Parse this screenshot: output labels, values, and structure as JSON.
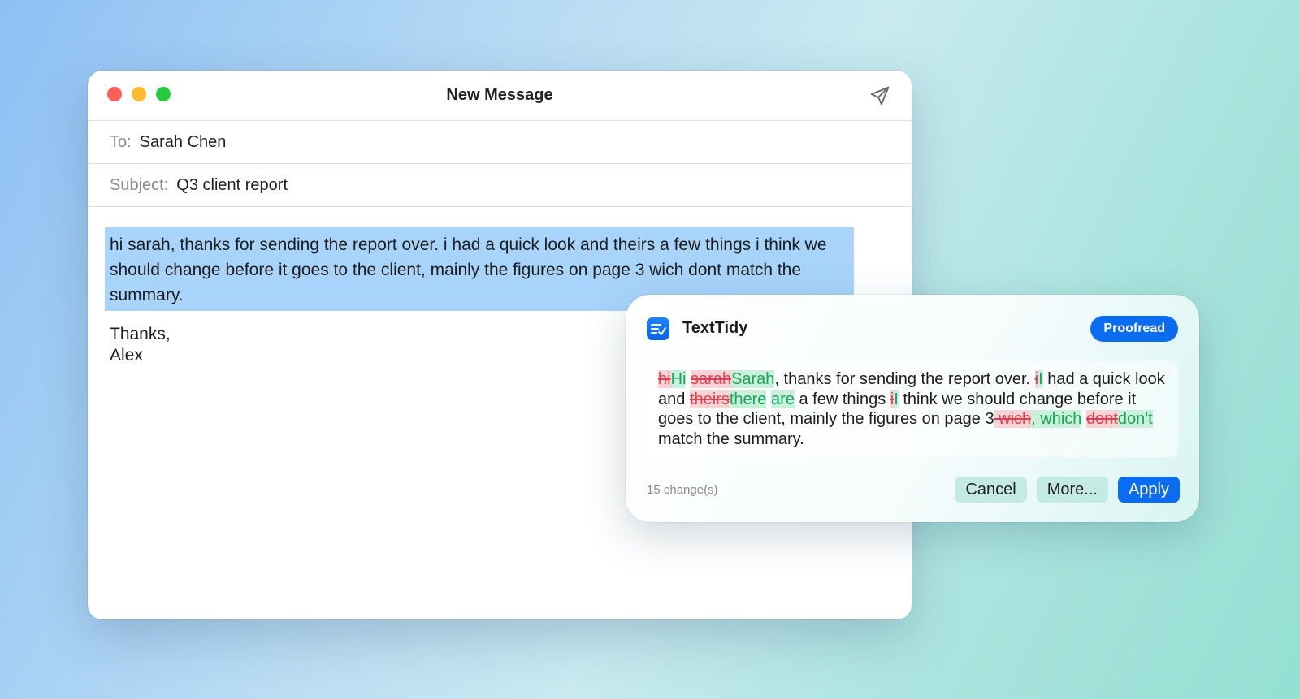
{
  "window": {
    "title": "New Message",
    "send_icon": "paper-plane-icon"
  },
  "fields": {
    "to_label": "To:",
    "to_value": "Sarah Chen",
    "subject_label": "Subject:",
    "subject_value": "Q3 client report"
  },
  "body": {
    "selected_text": "hi sarah, thanks for sending the report over. i had a quick look and theirs a few things i think we should change before it goes to the client, mainly the figures on page 3 wich dont match the summary.",
    "signoff": "Thanks,",
    "signature": "Alex"
  },
  "tidy": {
    "app_name": "TextTidy",
    "app_icon": "text-check-icon",
    "mode_label": "Proofread",
    "diff": {
      "d1": "hi",
      "i1": "Hi",
      "t1": " ",
      "d2": "sarah",
      "i2": "Sarah",
      "t2": ", thanks for sending the report over. ",
      "d3": "i",
      "i3": "I",
      "t3": " had a quick look and ",
      "d4": "theirs",
      "i4": "there",
      "t4": " ",
      "i5": "are",
      "t5": " a few things ",
      "d6": "i",
      "i6": "I",
      "t6": " think we should change before it goes to the client, mainly the figures on page 3",
      "d7": " wich",
      "i7": ", which",
      "t7": " ",
      "d8": "dont",
      "i8": "don't",
      "t8": " match the summary."
    },
    "change_count": "15 change(s)",
    "cancel_label": "Cancel",
    "more_label": "More...",
    "apply_label": "Apply"
  },
  "colors": {
    "accent": "#0a6cf0",
    "selection": "#a8d4fb",
    "deletion": "#e0404e",
    "insertion": "#1aa35a"
  }
}
